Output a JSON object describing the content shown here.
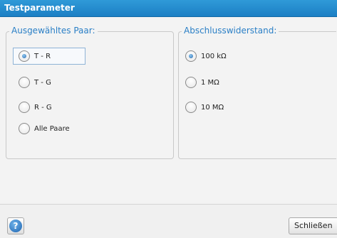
{
  "window": {
    "title": "Testparameter"
  },
  "pair_group": {
    "legend": "Ausgewähltes Paar:",
    "options": [
      {
        "label": "T - R",
        "selected": true
      },
      {
        "label": "T - G",
        "selected": false
      },
      {
        "label": "R - G",
        "selected": false
      },
      {
        "label": "Alle Paare",
        "selected": false
      }
    ]
  },
  "termination_group": {
    "legend": "Abschlusswiderstand:",
    "options": [
      {
        "label": "100 kΩ",
        "selected": true
      },
      {
        "label": "1 MΩ",
        "selected": false
      },
      {
        "label": "10 MΩ",
        "selected": false
      }
    ]
  },
  "footer": {
    "help_icon": "help-icon",
    "close_label": "Schließen"
  },
  "colors": {
    "titlebar": "#1c7fc4",
    "legend_text": "#2a7fc6",
    "panel_bg": "#f3f3f3"
  }
}
